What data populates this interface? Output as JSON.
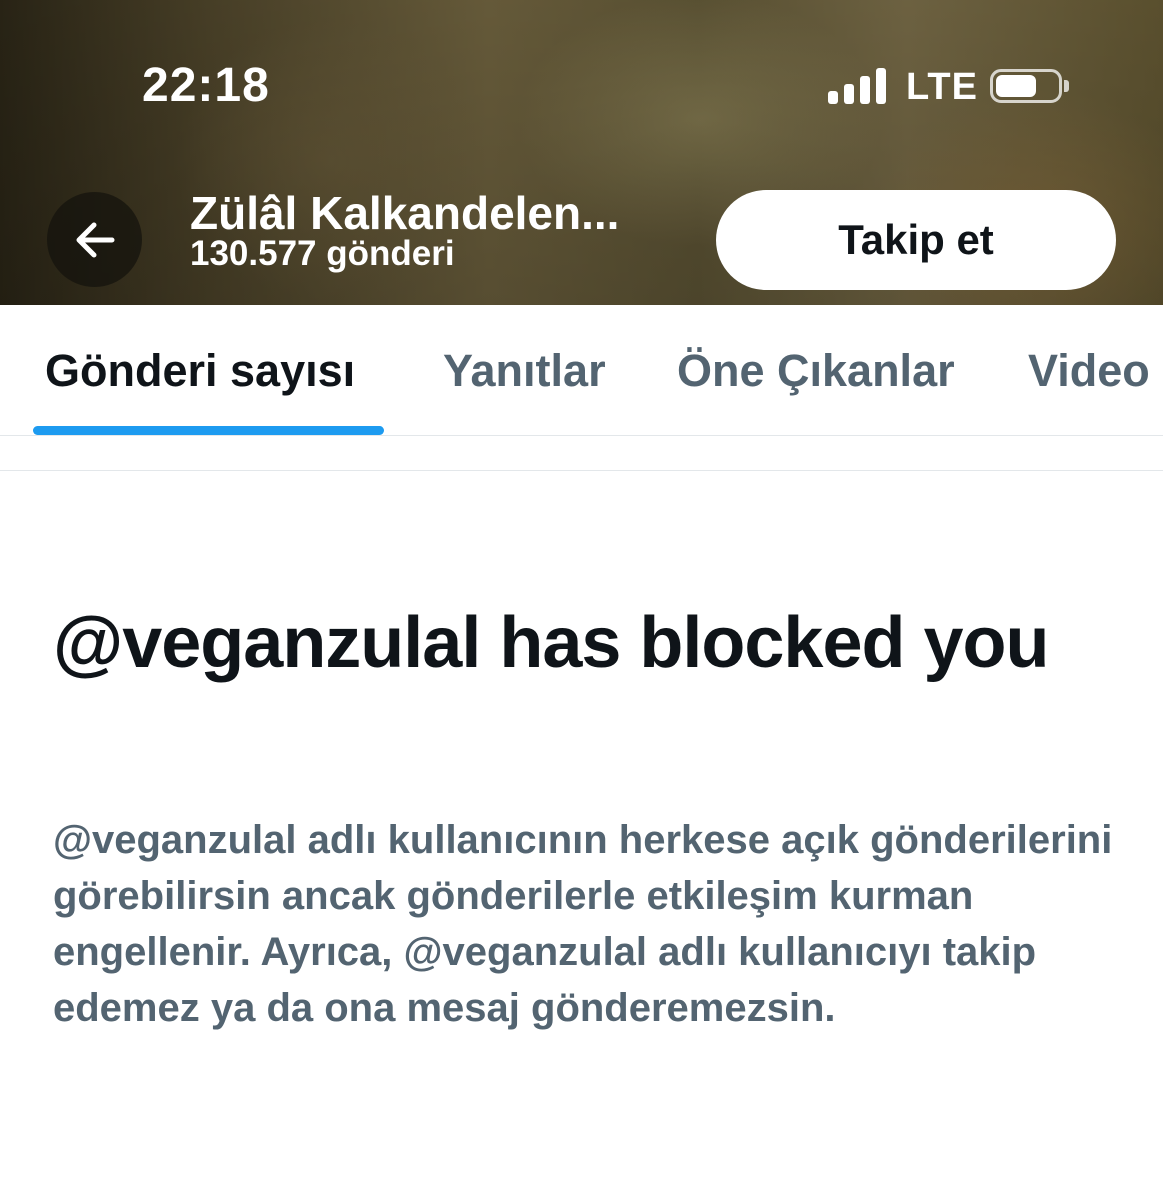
{
  "status_bar": {
    "time": "22:18",
    "network": "LTE",
    "signal_icon": "signal-bars-icon",
    "battery_icon": "battery-icon"
  },
  "header": {
    "back_icon": "arrow-left-icon",
    "profile_name": "Zülâl Kalkandelen...",
    "post_count": "130.577 gönderi",
    "follow_label": "Takip et"
  },
  "tabs": [
    {
      "label": "Gönderi sayısı",
      "active": true
    },
    {
      "label": "Yanıtlar",
      "active": false
    },
    {
      "label": "Öne Çıkanlar",
      "active": false
    },
    {
      "label": "Video",
      "active": false
    }
  ],
  "blocked": {
    "title": "@veganzulal has blocked you",
    "body": "@veganzulal adlı kullanıcının herkese açık gönderilerini görebilirsin ancak gönderilerle etkileşim kurman engellenir. Ayrıca, @veganzulal adlı kullanıcıyı takip edemez ya da ona mesaj gönderemezsin."
  },
  "colors": {
    "accent": "#1d9bf0",
    "text_primary": "#0f1419",
    "text_secondary": "#536471",
    "divider": "#e3e7ea"
  }
}
